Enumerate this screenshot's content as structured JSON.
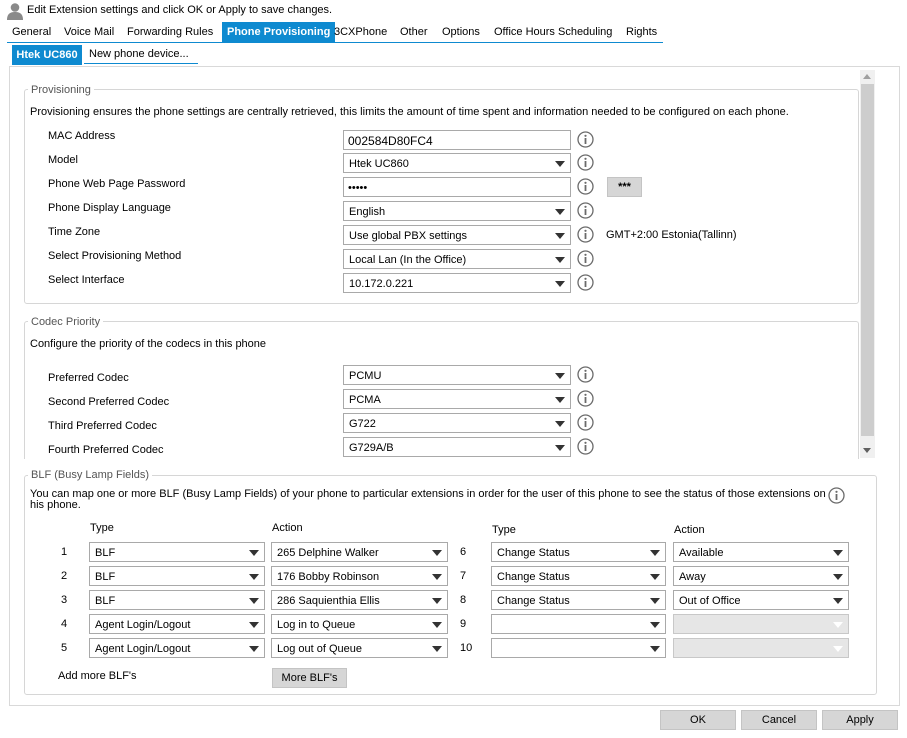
{
  "header": {
    "title": "Edit Extension settings and click OK or Apply to save changes."
  },
  "tabs": [
    "General",
    "Voice Mail",
    "Forwarding Rules",
    "Phone Provisioning",
    "3CXPhone",
    "Other",
    "Options",
    "Office Hours Scheduling",
    "Rights"
  ],
  "active_tab": "Phone Provisioning",
  "subtabs": [
    "Htek UC860",
    "New phone device..."
  ],
  "provisioning": {
    "legend": "Provisioning",
    "description": "Provisioning ensures the phone settings are centrally retrieved, this limits the amount of time spent and information needed to be configured on each phone.",
    "mac_label": "MAC Address",
    "mac_value": "002584D80FC4",
    "model_label": "Model",
    "model_value": "Htek UC860",
    "password_label": "Phone Web Page Password",
    "password_value": "•••••",
    "password_button": "***",
    "language_label": "Phone Display Language",
    "language_value": "English",
    "timezone_label": "Time Zone",
    "timezone_value": "Use global PBX settings",
    "timezone_note": "GMT+2:00 Estonia(Tallinn)",
    "method_label": "Select Provisioning Method",
    "method_value": "Local Lan (In the Office)",
    "interface_label": "Select Interface",
    "interface_value": "10.172.0.221"
  },
  "codec": {
    "legend": "Codec Priority",
    "description": "Configure the priority of the codecs in this phone",
    "rows": [
      {
        "label": "Preferred Codec",
        "value": "PCMU"
      },
      {
        "label": "Second Preferred Codec",
        "value": "PCMA"
      },
      {
        "label": "Third Preferred Codec",
        "value": "G722"
      },
      {
        "label": "Fourth Preferred Codec",
        "value": "G729A/B"
      }
    ]
  },
  "blf": {
    "legend": "BLF (Busy Lamp Fields)",
    "description_line1": "You can map one or more BLF (Busy Lamp Fields) of your phone to particular extensions in order for the user of this phone to see the status of those extensions on",
    "description_line2": "his phone.",
    "type_header": "Type",
    "action_header": "Action",
    "left_rows": [
      {
        "num": "1",
        "type": "BLF",
        "action": "265 Delphine Walker"
      },
      {
        "num": "2",
        "type": "BLF",
        "action": "176 Bobby Robinson"
      },
      {
        "num": "3",
        "type": "BLF",
        "action": "286 Saquienthia Ellis"
      },
      {
        "num": "4",
        "type": "Agent Login/Logout",
        "action": "Log in to Queue"
      },
      {
        "num": "5",
        "type": "Agent Login/Logout",
        "action": "Log out of Queue"
      }
    ],
    "right_rows": [
      {
        "num": "6",
        "type": "Change Status",
        "action": "Available"
      },
      {
        "num": "7",
        "type": "Change Status",
        "action": "Away"
      },
      {
        "num": "8",
        "type": "Change Status",
        "action": "Out of Office"
      },
      {
        "num": "9",
        "type": "",
        "action": ""
      },
      {
        "num": "10",
        "type": "",
        "action": ""
      }
    ],
    "add_more_label": "Add more BLF's",
    "more_button": "More BLF's"
  },
  "footer": {
    "ok": "OK",
    "cancel": "Cancel",
    "apply": "Apply"
  },
  "colors": {
    "accent": "#0e8ad0",
    "button_bg": "#d6d6d6",
    "border": "#d6d6d6"
  }
}
